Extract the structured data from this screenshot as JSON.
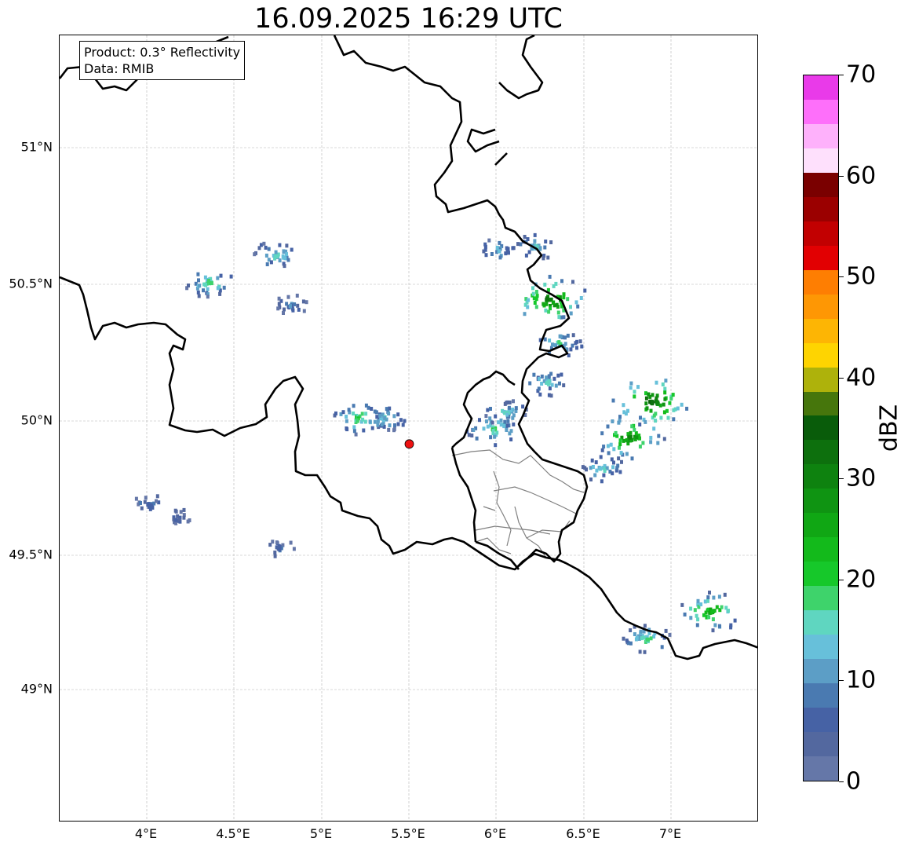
{
  "title": "16.09.2025 16:29 UTC",
  "info_box": {
    "product": "Product: 0.3° Reflectivity",
    "data": "Data: RMIB"
  },
  "axes": {
    "lat_labels": [
      "49°N",
      "49.5°N",
      "50°N",
      "50.5°N",
      "51°N"
    ],
    "lon_labels": [
      "4°E",
      "4.5°E",
      "5°E",
      "5.5°E",
      "6°E",
      "6.5°E",
      "7°E"
    ],
    "lat_values": [
      49.0,
      49.5,
      50.0,
      50.5,
      51.0
    ],
    "lon_values": [
      4.0,
      4.5,
      5.0,
      5.5,
      6.0,
      6.5,
      7.0
    ],
    "lon_range": [
      3.5,
      7.5
    ],
    "lat_range": [
      48.55,
      51.4
    ],
    "grid": "on"
  },
  "radar_site": {
    "lon": 5.5,
    "lat": 49.92,
    "color": "#ee1111"
  },
  "colorbar": {
    "label": "dBZ",
    "ticks": [
      "0",
      "10",
      "20",
      "30",
      "40",
      "50",
      "60",
      "70"
    ],
    "range": [
      0,
      70
    ],
    "colors": [
      "#6577a8",
      "#53689f",
      "#4662a5",
      "#4a7ab1",
      "#5c9ec6",
      "#67c0da",
      "#5fd6c0",
      "#3ed36b",
      "#16c82a",
      "#13ba1b",
      "#10a714",
      "#0f9412",
      "#0e820f",
      "#0d700d",
      "#095c0a",
      "#46760c",
      "#aeb20b",
      "#fed401",
      "#fdb504",
      "#fe9704",
      "#fe7e02",
      "#e20002",
      "#c20001",
      "#9b0000",
      "#7a0000",
      "#fee0fc",
      "#feb1fb",
      "#fe6ffa",
      "#e93ae9"
    ]
  },
  "echoes": [
    {
      "lon": 4.35,
      "lat": 50.51,
      "dbz": 18
    },
    {
      "lon": 4.73,
      "lat": 50.61,
      "dbz": 16
    },
    {
      "lon": 4.82,
      "lat": 50.43,
      "dbz": 10
    },
    {
      "lon": 4.0,
      "lat": 49.71,
      "dbz": 8
    },
    {
      "lon": 4.18,
      "lat": 49.66,
      "dbz": 6
    },
    {
      "lon": 4.75,
      "lat": 49.55,
      "dbz": 7
    },
    {
      "lon": 5.2,
      "lat": 50.02,
      "dbz": 20
    },
    {
      "lon": 5.35,
      "lat": 50.02,
      "dbz": 15
    },
    {
      "lon": 5.97,
      "lat": 49.98,
      "dbz": 20
    },
    {
      "lon": 6.05,
      "lat": 50.04,
      "dbz": 15
    },
    {
      "lon": 6.0,
      "lat": 50.63,
      "dbz": 12
    },
    {
      "lon": 6.22,
      "lat": 50.64,
      "dbz": 14
    },
    {
      "lon": 6.3,
      "lat": 50.45,
      "dbz": 32
    },
    {
      "lon": 6.35,
      "lat": 50.29,
      "dbz": 16
    },
    {
      "lon": 6.28,
      "lat": 50.15,
      "dbz": 15
    },
    {
      "lon": 6.88,
      "lat": 50.08,
      "dbz": 34
    },
    {
      "lon": 6.75,
      "lat": 49.95,
      "dbz": 30
    },
    {
      "lon": 6.6,
      "lat": 49.84,
      "dbz": 16
    },
    {
      "lon": 7.22,
      "lat": 49.32,
      "dbz": 26
    },
    {
      "lon": 6.85,
      "lat": 49.22,
      "dbz": 18
    }
  ]
}
